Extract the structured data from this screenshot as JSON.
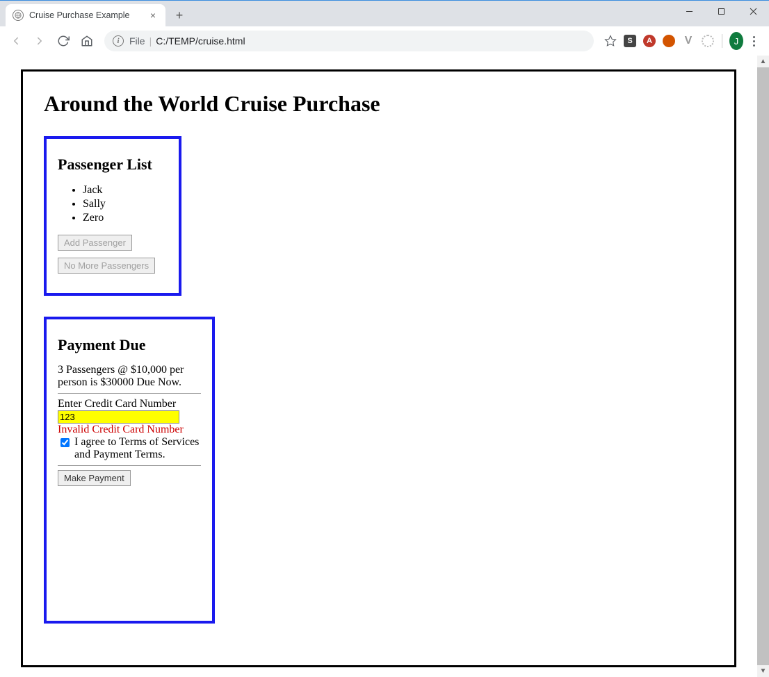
{
  "browser": {
    "tab_title": "Cruise Purchase Example",
    "url_label": "File",
    "url_path": "C:/TEMP/cruise.html",
    "avatar_initial": "J",
    "ext_s_label": "S",
    "ext_a_label": "A",
    "ext_v_label": "V"
  },
  "page": {
    "title": "Around the World Cruise Purchase"
  },
  "passenger_panel": {
    "title": "Passenger List",
    "passengers": [
      "Jack",
      "Sally",
      "Zero"
    ],
    "add_button": "Add Passenger",
    "done_button": "No More Passengers"
  },
  "payment_panel": {
    "title": "Payment Due",
    "summary": "3 Passengers @ $10,000 per person is $30000 Due Now.",
    "cc_label": "Enter Credit Card Number",
    "cc_value": "123",
    "cc_error": "Invalid Credit Card Number",
    "agree_label": " I agree to Terms of Services and Payment Terms.",
    "agree_checked": true,
    "pay_button": "Make Payment"
  }
}
